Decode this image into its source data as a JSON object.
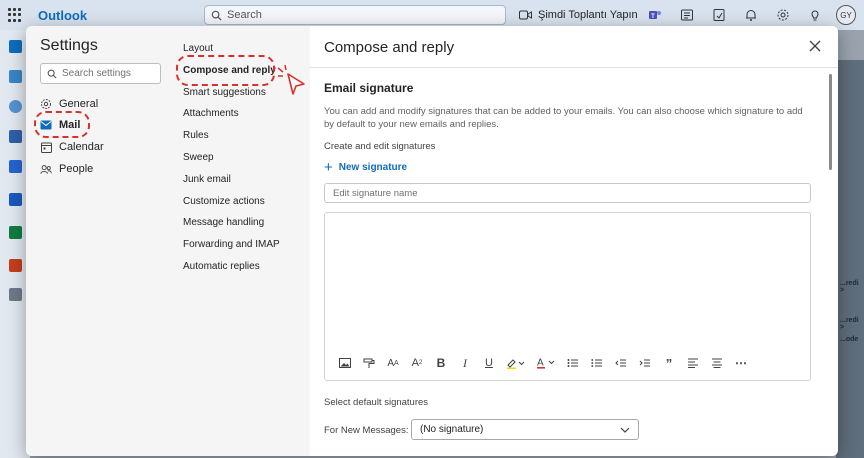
{
  "topbar": {
    "brand": "Outlook",
    "search_placeholder": "Search",
    "meet_now": "Şimdi Toplantı Yapın",
    "avatar_initials": "GY"
  },
  "background_ads": [
    "...redi >",
    "...redi >",
    "...ode"
  ],
  "settings": {
    "title": "Settings",
    "search_placeholder": "Search settings",
    "categories": [
      {
        "label": "General",
        "icon": "gear-icon"
      },
      {
        "label": "Mail",
        "icon": "mail-icon",
        "active": true
      },
      {
        "label": "Calendar",
        "icon": "calendar-icon"
      },
      {
        "label": "People",
        "icon": "people-icon"
      }
    ],
    "subcategories": [
      {
        "label": "Layout"
      },
      {
        "label": "Compose and reply",
        "active": true
      },
      {
        "label": "Smart suggestions"
      },
      {
        "label": "Attachments"
      },
      {
        "label": "Rules"
      },
      {
        "label": "Sweep"
      },
      {
        "label": "Junk email"
      },
      {
        "label": "Customize actions"
      },
      {
        "label": "Message handling"
      },
      {
        "label": "Forwarding and IMAP"
      },
      {
        "label": "Automatic replies"
      }
    ]
  },
  "pane": {
    "title": "Compose and reply",
    "section_title": "Email signature",
    "description": "You can add and modify signatures that can be added to your emails. You can also choose which signature to add by default to your new emails and replies.",
    "create_label": "Create and edit signatures",
    "new_signature": "New signature",
    "signature_name_placeholder": "Edit signature name",
    "toolbar": [
      "image-icon",
      "format-painter-icon",
      "font-size-icon",
      "superscript-icon",
      "bold-icon",
      "italic-icon",
      "underline-icon",
      "highlight-icon",
      "font-color-icon",
      "bullets-icon",
      "numbering-icon",
      "outdent-icon",
      "indent-icon",
      "quote-icon",
      "align-left-icon",
      "align-center-icon",
      "more-icon"
    ],
    "defaults_label": "Select default signatures",
    "new_messages_label": "For New Messages:",
    "new_messages_value": "(No signature)"
  },
  "colors": {
    "accent": "#0f6cbd",
    "annotation": "#d9302c"
  }
}
